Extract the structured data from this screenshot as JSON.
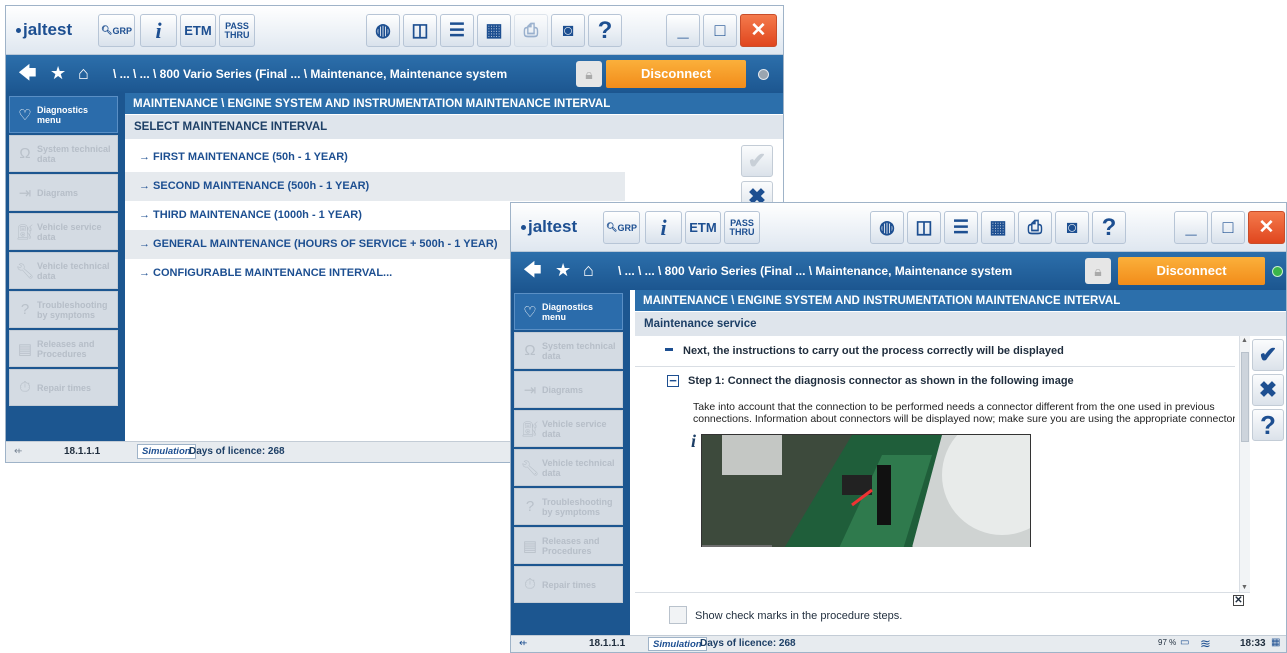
{
  "app": {
    "logo_text": "jaltest",
    "toolbar": {
      "grp_label": "GRP",
      "info_label": "i",
      "etm_label": "ETM",
      "pass_label_1": "PASS",
      "pass_label_2": "THRU",
      "help_label": "?",
      "minimize_label": "_",
      "maximize_label": "□",
      "close_label": "✕"
    },
    "breadcrumb": "\\ ... \\ ... \\ 800 Vario Series (Final ... \\ Maintenance, Maintenance system",
    "disconnect_label": "Disconnect",
    "sidebar": [
      {
        "label_1": "Diagnostics",
        "label_2": "menu",
        "icon": "stethoscope-icon",
        "active": true
      },
      {
        "label_1": "System technical",
        "label_2": "data",
        "icon": "omega-icon",
        "active": false
      },
      {
        "label_1": "Diagrams",
        "label_2": "",
        "icon": "diagram-icon",
        "active": false
      },
      {
        "label_1": "Vehicle service",
        "label_2": "data",
        "icon": "oil-can-icon",
        "active": false
      },
      {
        "label_1": "Vehicle technical",
        "label_2": "data",
        "icon": "wrench-icon",
        "active": false
      },
      {
        "label_1": "Troubleshooting",
        "label_2": "by symptoms",
        "icon": "troubleshooting-icon",
        "active": false
      },
      {
        "label_1": "Releases and",
        "label_2": "Procedures",
        "icon": "procedures-icon",
        "active": false
      },
      {
        "label_1": "Repair times",
        "label_2": "",
        "icon": "repair-times-icon",
        "active": false
      }
    ],
    "status": {
      "version": "18.1.1.1",
      "simulation": "Simulation",
      "licence": "Days of licence: 268",
      "battery": "97 %",
      "time": "18:33"
    }
  },
  "window1": {
    "header": "MAINTENANCE \\ ENGINE SYSTEM AND INSTRUMENTATION MAINTENANCE INTERVAL",
    "subheader": "SELECT MAINTENANCE INTERVAL",
    "items": [
      "→  FIRST MAINTENANCE (50h - 1 YEAR)",
      "→  SECOND MAINTENANCE (500h - 1 YEAR)",
      "→  THIRD MAINTENANCE (1000h - 1 YEAR)",
      "→  GENERAL MAINTENANCE (HOURS OF SERVICE + 500h - 1 YEAR)",
      "→  CONFIGURABLE MAINTENANCE INTERVAL..."
    ],
    "accept_label": "✔",
    "cancel_label": "✖"
  },
  "window2": {
    "header": "MAINTENANCE \\ ENGINE SYSTEM AND INSTRUMENTATION MAINTENANCE INTERVAL",
    "subheader": "Maintenance service",
    "intro": "Next, the instructions to carry out the process correctly will be displayed",
    "step_title": "Step 1: Connect the diagnosis connector as shown in the following image",
    "step_text": "Take into account that the connection to be performed needs a connector different from the one used in previous connections. Information about connectors will be displayed now; make sure you are using the appropriate connector.",
    "info_mark": "i",
    "checkbox_label": "Show check marks in the procedure steps.",
    "accept_label": "✔",
    "cancel_label": "✖",
    "help_label": "?",
    "close_small": "✕"
  },
  "colors": {
    "brand_blue": "#1d5690",
    "header_blue": "#2c6fab",
    "disconnect_orange": "#f59a24",
    "close_red": "#e0461e",
    "led_grey": "#9aa5b0",
    "led_green": "#3bb54a"
  }
}
